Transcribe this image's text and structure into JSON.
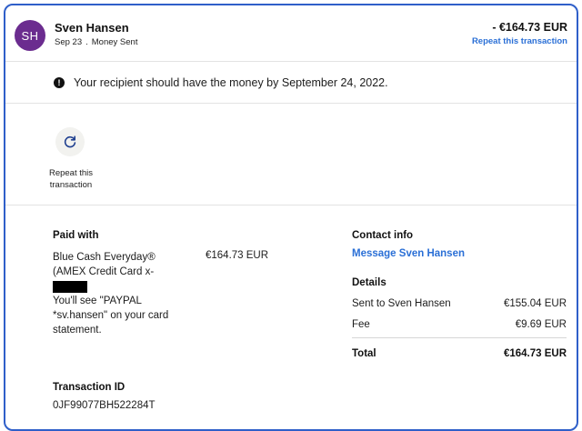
{
  "header": {
    "avatar_initials": "SH",
    "name": "Sven Hansen",
    "date": "Sep 23",
    "separator": ".",
    "type": "Money Sent",
    "amount": "- €164.73 EUR",
    "repeat_link": "Repeat this transaction"
  },
  "banner": {
    "icon": "info-icon",
    "icon_glyph": "!",
    "text": "Your recipient should have the money by September 24, 2022."
  },
  "repeat_action": {
    "icon": "refresh-icon",
    "label": "Repeat this transaction"
  },
  "paid_with": {
    "heading": "Paid with",
    "card_name_line": "Blue Cash Everyday® (AMEX Credit Card x-",
    "statement_note": "You'll see \"PAYPAL *sv.hansen\" on your card statement.",
    "amount": "€164.73 EUR"
  },
  "transaction": {
    "heading": "Transaction ID",
    "id": "0JF99077BH522284T"
  },
  "contact": {
    "heading": "Contact info",
    "message_link": "Message Sven Hansen"
  },
  "details": {
    "heading": "Details",
    "sent_label": "Sent to Sven Hansen",
    "sent_value": "€155.04 EUR",
    "fee_label": "Fee",
    "fee_value": "€9.69 EUR",
    "total_label": "Total",
    "total_value": "€164.73 EUR"
  },
  "colors": {
    "accent": "#2a6fd6",
    "avatar": "#6b2c8f",
    "frame_border": "#2f5fc9"
  }
}
